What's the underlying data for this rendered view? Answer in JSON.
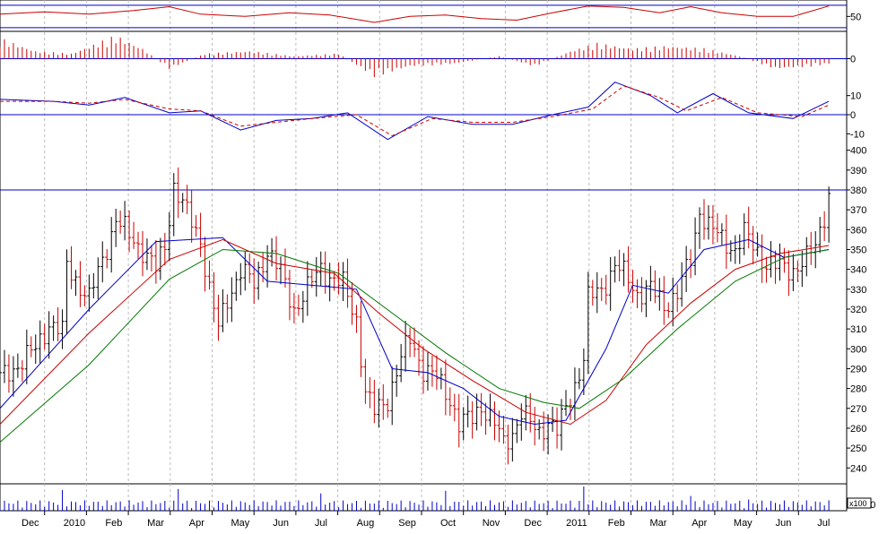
{
  "chart_data": {
    "type": "line",
    "chart_kind": "stock price chart (OHLC bars) with three moving averages, volume histogram and three indicator sub-panels",
    "x_axis": {
      "labels": [
        "Dec",
        "2010",
        "Feb",
        "Mar",
        "Apr",
        "May",
        "Jun",
        "Jul",
        "Aug",
        "Sep",
        "Oct",
        "Nov",
        "Dec",
        "2011",
        "Feb",
        "Mar",
        "Apr",
        "May",
        "Jun",
        "Jul"
      ],
      "range": [
        "2009-12",
        "2011-07"
      ],
      "grid": "vertical dashed gridline at each month boundary"
    },
    "price_panel": {
      "ylim": [
        232,
        403
      ],
      "yticks": [
        240,
        250,
        260,
        270,
        280,
        290,
        300,
        310,
        320,
        330,
        340,
        350,
        360,
        370,
        380,
        390,
        400
      ],
      "reference_line": 380,
      "price_series": [
        {
          "t": 0,
          "v": 285
        },
        {
          "t": 4,
          "v": 292
        },
        {
          "t": 8,
          "v": 300
        },
        {
          "t": 11,
          "v": 313
        },
        {
          "t": 14,
          "v": 308
        },
        {
          "t": 15,
          "v": 342
        },
        {
          "t": 17,
          "v": 335
        },
        {
          "t": 20,
          "v": 325
        },
        {
          "t": 23,
          "v": 345
        },
        {
          "t": 26,
          "v": 365
        },
        {
          "t": 29,
          "v": 357
        },
        {
          "t": 32,
          "v": 350
        },
        {
          "t": 35,
          "v": 340
        },
        {
          "t": 37,
          "v": 352
        },
        {
          "t": 39,
          "v": 382
        },
        {
          "t": 42,
          "v": 368
        },
        {
          "t": 45,
          "v": 355
        },
        {
          "t": 47,
          "v": 330
        },
        {
          "t": 49,
          "v": 310
        },
        {
          "t": 51,
          "v": 325
        },
        {
          "t": 54,
          "v": 340
        },
        {
          "t": 57,
          "v": 332
        },
        {
          "t": 60,
          "v": 350
        },
        {
          "t": 63,
          "v": 338
        },
        {
          "t": 66,
          "v": 320
        },
        {
          "t": 69,
          "v": 330
        },
        {
          "t": 72,
          "v": 341
        },
        {
          "t": 74,
          "v": 336
        },
        {
          "t": 77,
          "v": 332
        },
        {
          "t": 80,
          "v": 315
        },
        {
          "t": 82,
          "v": 278
        },
        {
          "t": 84,
          "v": 268
        },
        {
          "t": 87,
          "v": 275
        },
        {
          "t": 90,
          "v": 295
        },
        {
          "t": 92,
          "v": 305
        },
        {
          "t": 95,
          "v": 290
        },
        {
          "t": 98,
          "v": 285
        },
        {
          "t": 101,
          "v": 275
        },
        {
          "t": 103,
          "v": 262
        },
        {
          "t": 106,
          "v": 265
        },
        {
          "t": 108,
          "v": 272
        },
        {
          "t": 111,
          "v": 262
        },
        {
          "t": 113,
          "v": 252
        },
        {
          "t": 115,
          "v": 258
        },
        {
          "t": 117,
          "v": 268
        },
        {
          "t": 119,
          "v": 262
        },
        {
          "t": 121,
          "v": 258
        },
        {
          "t": 123,
          "v": 264
        },
        {
          "t": 125,
          "v": 258
        },
        {
          "t": 127,
          "v": 270
        },
        {
          "t": 129,
          "v": 282
        },
        {
          "t": 131,
          "v": 295
        },
        {
          "t": 132,
          "v": 325
        },
        {
          "t": 135,
          "v": 330
        },
        {
          "t": 138,
          "v": 342
        },
        {
          "t": 141,
          "v": 335
        },
        {
          "t": 143,
          "v": 328
        },
        {
          "t": 146,
          "v": 330
        },
        {
          "t": 149,
          "v": 322
        },
        {
          "t": 152,
          "v": 328
        },
        {
          "t": 155,
          "v": 345
        },
        {
          "t": 157,
          "v": 370
        },
        {
          "t": 159,
          "v": 362
        },
        {
          "t": 162,
          "v": 355
        },
        {
          "t": 165,
          "v": 350
        },
        {
          "t": 167,
          "v": 358
        },
        {
          "t": 169,
          "v": 352
        },
        {
          "t": 172,
          "v": 343
        },
        {
          "t": 175,
          "v": 341
        },
        {
          "t": 178,
          "v": 340
        },
        {
          "t": 181,
          "v": 345
        },
        {
          "t": 183,
          "v": 352
        },
        {
          "t": 185,
          "v": 368
        },
        {
          "t": 186,
          "v": 378
        }
      ],
      "moving_averages": [
        {
          "name": "short MA",
          "color": "#0000cc",
          "values": [
            {
              "t": 0,
              "v": 270
            },
            {
              "t": 20,
              "v": 320
            },
            {
              "t": 35,
              "v": 354
            },
            {
              "t": 50,
              "v": 356
            },
            {
              "t": 60,
              "v": 334
            },
            {
              "t": 70,
              "v": 332
            },
            {
              "t": 80,
              "v": 330
            },
            {
              "t": 88,
              "v": 290
            },
            {
              "t": 96,
              "v": 288
            },
            {
              "t": 104,
              "v": 280
            },
            {
              "t": 112,
              "v": 266
            },
            {
              "t": 120,
              "v": 262
            },
            {
              "t": 127,
              "v": 264
            },
            {
              "t": 136,
              "v": 300
            },
            {
              "t": 142,
              "v": 332
            },
            {
              "t": 150,
              "v": 328
            },
            {
              "t": 158,
              "v": 350
            },
            {
              "t": 168,
              "v": 355
            },
            {
              "t": 176,
              "v": 346
            },
            {
              "t": 186,
              "v": 350
            }
          ]
        },
        {
          "name": "medium MA",
          "color": "#cc0000",
          "values": [
            {
              "t": 0,
              "v": 262
            },
            {
              "t": 20,
              "v": 308
            },
            {
              "t": 38,
              "v": 345
            },
            {
              "t": 50,
              "v": 355
            },
            {
              "t": 62,
              "v": 343
            },
            {
              "t": 75,
              "v": 338
            },
            {
              "t": 85,
              "v": 318
            },
            {
              "t": 95,
              "v": 300
            },
            {
              "t": 106,
              "v": 284
            },
            {
              "t": 118,
              "v": 268
            },
            {
              "t": 128,
              "v": 262
            },
            {
              "t": 136,
              "v": 274
            },
            {
              "t": 145,
              "v": 302
            },
            {
              "t": 155,
              "v": 323
            },
            {
              "t": 165,
              "v": 340
            },
            {
              "t": 175,
              "v": 348
            },
            {
              "t": 186,
              "v": 352
            }
          ]
        },
        {
          "name": "long MA",
          "color": "#007700",
          "values": [
            {
              "t": 0,
              "v": 253
            },
            {
              "t": 20,
              "v": 292
            },
            {
              "t": 38,
              "v": 335
            },
            {
              "t": 50,
              "v": 350
            },
            {
              "t": 62,
              "v": 348
            },
            {
              "t": 76,
              "v": 338
            },
            {
              "t": 88,
              "v": 318
            },
            {
              "t": 100,
              "v": 298
            },
            {
              "t": 112,
              "v": 280
            },
            {
              "t": 122,
              "v": 273
            },
            {
              "t": 130,
              "v": 270
            },
            {
              "t": 140,
              "v": 285
            },
            {
              "t": 152,
              "v": 310
            },
            {
              "t": 165,
              "v": 334
            },
            {
              "t": 176,
              "v": 346
            },
            {
              "t": 186,
              "v": 350
            }
          ]
        }
      ]
    },
    "volume_panel": {
      "ylim": [
        0,
        3000
      ],
      "ytick_label": "000",
      "multiplier_label": "x100",
      "spikes": [
        {
          "t": 14,
          "v": 2400
        },
        {
          "t": 40,
          "v": 2500
        },
        {
          "t": 72,
          "v": 2000
        },
        {
          "t": 100,
          "v": 2300
        },
        {
          "t": 131,
          "v": 2800
        },
        {
          "t": 155,
          "v": 1700
        },
        {
          "t": 168,
          "v": 1300
        }
      ]
    },
    "panel1": {
      "ylim": [
        30,
        72
      ],
      "yticks": [
        50
      ],
      "reference_lines": [
        65,
        35
      ],
      "color": "#cc0000",
      "values": [
        {
          "t": 0,
          "v": 53
        },
        {
          "t": 10,
          "v": 56
        },
        {
          "t": 20,
          "v": 53
        },
        {
          "t": 30,
          "v": 58
        },
        {
          "t": 38,
          "v": 63
        },
        {
          "t": 45,
          "v": 53
        },
        {
          "t": 55,
          "v": 50
        },
        {
          "t": 65,
          "v": 55
        },
        {
          "t": 74,
          "v": 52
        },
        {
          "t": 84,
          "v": 42
        },
        {
          "t": 92,
          "v": 50
        },
        {
          "t": 100,
          "v": 52
        },
        {
          "t": 108,
          "v": 47
        },
        {
          "t": 116,
          "v": 45
        },
        {
          "t": 124,
          "v": 55
        },
        {
          "t": 132,
          "v": 64
        },
        {
          "t": 140,
          "v": 62
        },
        {
          "t": 148,
          "v": 55
        },
        {
          "t": 155,
          "v": 63
        },
        {
          "t": 162,
          "v": 55
        },
        {
          "t": 170,
          "v": 50
        },
        {
          "t": 178,
          "v": 50
        },
        {
          "t": 186,
          "v": 64
        }
      ]
    },
    "panel2": {
      "ylim": [
        -1,
        1
      ],
      "yticks": [
        0
      ],
      "color": "#cc0000",
      "values": [
        {
          "t": 0,
          "v": 0.8
        },
        {
          "t": 8,
          "v": 0.3
        },
        {
          "t": 16,
          "v": 0.2
        },
        {
          "t": 26,
          "v": 0.9
        },
        {
          "t": 32,
          "v": 0.4
        },
        {
          "t": 38,
          "v": -0.4
        },
        {
          "t": 46,
          "v": 0.2
        },
        {
          "t": 56,
          "v": 0.3
        },
        {
          "t": 66,
          "v": 0.1
        },
        {
          "t": 76,
          "v": 0.2
        },
        {
          "t": 84,
          "v": -0.7
        },
        {
          "t": 92,
          "v": -0.3
        },
        {
          "t": 102,
          "v": -0.2
        },
        {
          "t": 112,
          "v": 0.1
        },
        {
          "t": 120,
          "v": -0.3
        },
        {
          "t": 128,
          "v": 0.3
        },
        {
          "t": 134,
          "v": 0.6
        },
        {
          "t": 142,
          "v": 0.4
        },
        {
          "t": 150,
          "v": 0.5
        },
        {
          "t": 158,
          "v": 0.4
        },
        {
          "t": 166,
          "v": 0.1
        },
        {
          "t": 174,
          "v": -0.4
        },
        {
          "t": 182,
          "v": -0.3
        },
        {
          "t": 186,
          "v": -0.2
        }
      ]
    },
    "panel3": {
      "ylim": [
        -15,
        15
      ],
      "yticks": [
        10,
        0,
        -10
      ],
      "reference_line": 0,
      "series": [
        {
          "name": "line",
          "color": "#0000cc",
          "values": [
            {
              "t": 0,
              "v": 8
            },
            {
              "t": 12,
              "v": 7
            },
            {
              "t": 20,
              "v": 5
            },
            {
              "t": 28,
              "v": 9
            },
            {
              "t": 38,
              "v": 1
            },
            {
              "t": 45,
              "v": 2
            },
            {
              "t": 54,
              "v": -8
            },
            {
              "t": 62,
              "v": -3
            },
            {
              "t": 70,
              "v": -2
            },
            {
              "t": 78,
              "v": 1
            },
            {
              "t": 87,
              "v": -13
            },
            {
              "t": 96,
              "v": -1
            },
            {
              "t": 106,
              "v": -5
            },
            {
              "t": 115,
              "v": -5
            },
            {
              "t": 124,
              "v": 0
            },
            {
              "t": 132,
              "v": 4
            },
            {
              "t": 138,
              "v": 17
            },
            {
              "t": 146,
              "v": 10
            },
            {
              "t": 152,
              "v": 1
            },
            {
              "t": 160,
              "v": 11
            },
            {
              "t": 168,
              "v": 1
            },
            {
              "t": 178,
              "v": -2
            },
            {
              "t": 186,
              "v": 7
            }
          ]
        },
        {
          "name": "signal",
          "color": "#cc0000",
          "dashed": true,
          "values": [
            {
              "t": 0,
              "v": 7
            },
            {
              "t": 12,
              "v": 7
            },
            {
              "t": 20,
              "v": 6
            },
            {
              "t": 28,
              "v": 8
            },
            {
              "t": 38,
              "v": 3
            },
            {
              "t": 45,
              "v": 2
            },
            {
              "t": 54,
              "v": -6
            },
            {
              "t": 62,
              "v": -4
            },
            {
              "t": 70,
              "v": -2
            },
            {
              "t": 80,
              "v": 0
            },
            {
              "t": 88,
              "v": -11
            },
            {
              "t": 97,
              "v": -2
            },
            {
              "t": 106,
              "v": -4
            },
            {
              "t": 115,
              "v": -4
            },
            {
              "t": 124,
              "v": -1
            },
            {
              "t": 133,
              "v": 3
            },
            {
              "t": 140,
              "v": 15
            },
            {
              "t": 148,
              "v": 9
            },
            {
              "t": 154,
              "v": 2
            },
            {
              "t": 162,
              "v": 9
            },
            {
              "t": 170,
              "v": 1
            },
            {
              "t": 180,
              "v": -1
            },
            {
              "t": 186,
              "v": 5
            }
          ]
        }
      ]
    },
    "colors": {
      "up_bar": "#000000",
      "down_bar": "#cc0000",
      "reference_line": "#0000cc",
      "volume": "#0000cc",
      "grid": "#bbbbbb"
    }
  }
}
